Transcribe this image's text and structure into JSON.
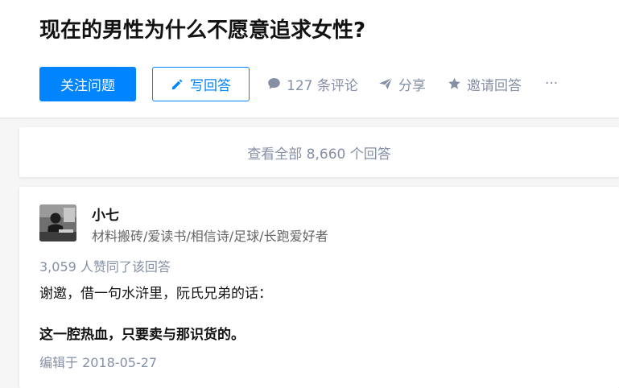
{
  "question": {
    "title": "现在的男性为什么不愿意追求女性?"
  },
  "actions": {
    "follow_label": "关注问题",
    "write_label": "写回答",
    "comments_label": "127 条评论",
    "share_label": "分享",
    "invite_label": "邀请回答",
    "more_label": "···"
  },
  "view_all": {
    "label": "查看全部 8,660 个回答"
  },
  "answer": {
    "author_name": "小七",
    "author_bio": "材料搬砖/爱读书/相信诗/足球/长跑爱好者",
    "votes_text": "3,059 人赞同了该回答",
    "paragraph1": "谢邀，借一句水浒里，阮氏兄弟的话：",
    "paragraph2": "这一腔热血，只要卖与那识货的。",
    "edited_text": "编辑于 2018-05-27"
  },
  "colors": {
    "primary": "#0084ff",
    "muted": "#8590a6",
    "text": "#121212",
    "background": "#f6f6f6"
  },
  "icons": {
    "write": "pencil-icon",
    "comments": "comment-bubble-icon",
    "share": "paper-plane-icon",
    "invite": "star-icon",
    "more": "more-dots-icon"
  }
}
